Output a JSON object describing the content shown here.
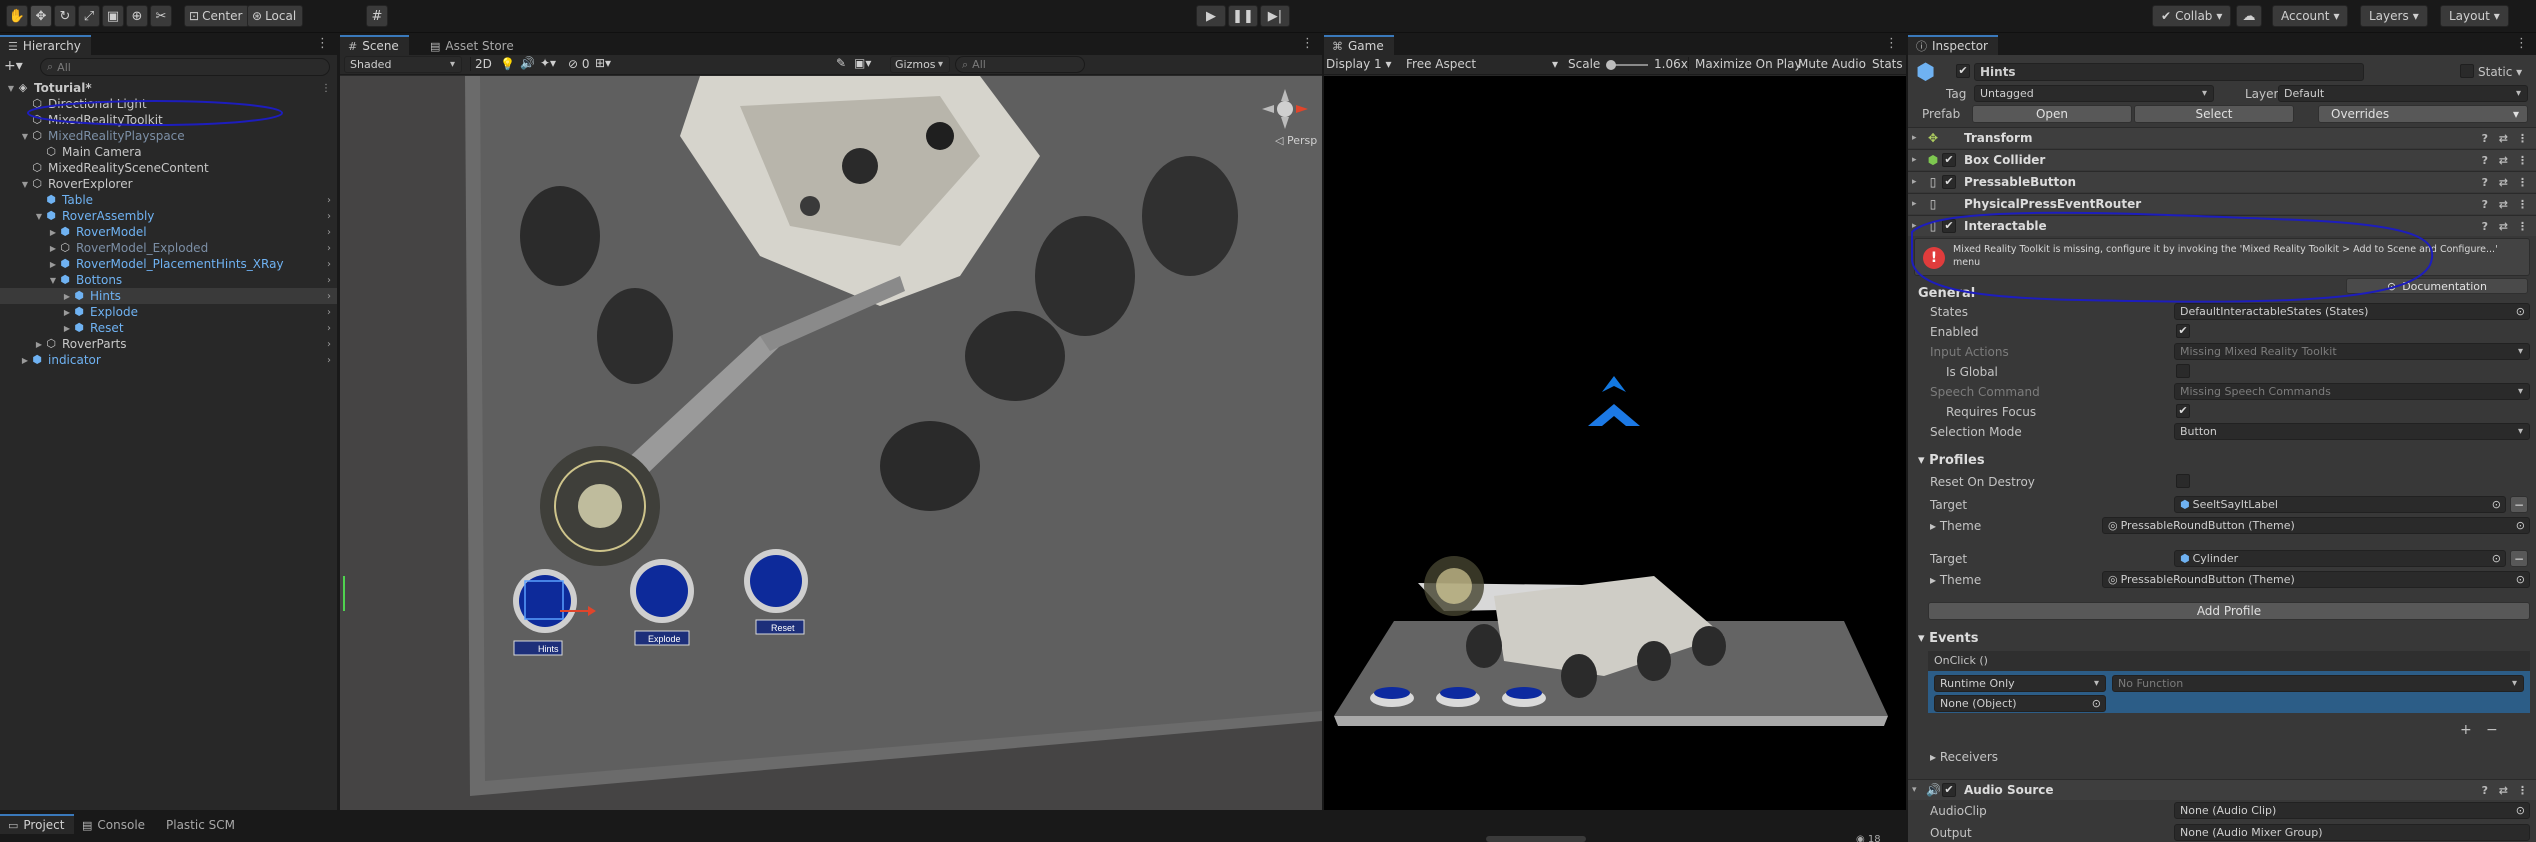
{
  "toolbar": {
    "pivot_label": "Center",
    "space_label": "Local",
    "collab_label": "Collab",
    "account_label": "Account",
    "layers_label": "Layers",
    "layout_label": "Layout"
  },
  "hierarchy": {
    "tab_label": "Hierarchy",
    "search_placeholder": "All",
    "items": [
      {
        "label": "Toturial*",
        "depth": 0
      },
      {
        "label": "Directional Light",
        "depth": 1
      },
      {
        "label": "MixedRealityToolkit",
        "depth": 1
      },
      {
        "label": "MixedRealityPlayspace",
        "depth": 1
      },
      {
        "label": "Main Camera",
        "depth": 2
      },
      {
        "label": "MixedRealitySceneContent",
        "depth": 1
      },
      {
        "label": "RoverExplorer",
        "depth": 1
      },
      {
        "label": "Table",
        "depth": 2
      },
      {
        "label": "RoverAssembly",
        "depth": 2
      },
      {
        "label": "RoverModel",
        "depth": 3
      },
      {
        "label": "RoverModel_Exploded",
        "depth": 3
      },
      {
        "label": "RoverModel_PlacementHints_XRay",
        "depth": 3
      },
      {
        "label": "Bottons",
        "depth": 3
      },
      {
        "label": "Hints",
        "depth": 4
      },
      {
        "label": "Explode",
        "depth": 4
      },
      {
        "label": "Reset",
        "depth": 4
      },
      {
        "label": "RoverParts",
        "depth": 2
      },
      {
        "label": "indicator",
        "depth": 1
      }
    ]
  },
  "scene": {
    "tab_label": "Scene",
    "tab2_label": "Asset Store",
    "shading": "Shaded",
    "mode_2d": "2D",
    "hidden_count": "0",
    "gizmos_label": "Gizmos",
    "search_placeholder": "All",
    "persp_label": "Persp",
    "buttons": [
      "Hints",
      "Explode",
      "Reset"
    ]
  },
  "game": {
    "tab_label": "Game",
    "display": "Display 1",
    "aspect": "Free Aspect",
    "scale_label": "Scale",
    "scale_value": "1.06x",
    "maximize_label": "Maximize On Play",
    "mute_label": "Mute Audio",
    "stats_label": "Stats"
  },
  "inspector": {
    "tab_label": "Inspector",
    "object_name": "Hints",
    "static_label": "Static",
    "tag_label": "Tag",
    "tag_value": "Untagged",
    "layer_label": "Layer",
    "layer_value": "Default",
    "prefab_label": "Prefab",
    "open_label": "Open",
    "select_label": "Select",
    "overrides_label": "Overrides",
    "components": [
      "Transform",
      "Box Collider",
      "PressableButton",
      "PhysicalPressEventRouter",
      "Interactable"
    ],
    "error_text": "Mixed Reality Toolkit is missing, configure it by invoking the 'Mixed Reality Toolkit > Add to Scene and Configure...' menu",
    "documentation_label": "Documentation",
    "general_label": "General",
    "states_label": "States",
    "states_value": "DefaultInteractableStates (States)",
    "enabled_label": "Enabled",
    "input_actions_label": "Input Actions",
    "input_actions_value": "Missing Mixed Reality Toolkit",
    "is_global_label": "Is Global",
    "speech_label": "Speech Command",
    "speech_value": "Missing Speech Commands",
    "requires_focus_label": "Requires Focus",
    "selection_mode_label": "Selection Mode",
    "selection_mode_value": "Button",
    "profiles_label": "Profiles",
    "reset_label": "Reset On Destroy",
    "target_label": "Target",
    "theme_label": "Theme",
    "target1_value": "SeeltSayItLabel",
    "theme1_value": "PressableRoundButton (Theme)",
    "target2_value": "Cylinder",
    "theme2_value": "PressableRoundButton (Theme)",
    "add_profile_label": "Add Profile",
    "events_label": "Events",
    "onclick_label": "OnClick ()",
    "runtime_value": "Runtime Only",
    "function_value": "No Function",
    "object_value": "None (Object)",
    "receivers_label": "Receivers",
    "audio_source_label": "Audio Source",
    "audioclip_label": "AudioClip",
    "audioclip_value": "None (Audio Clip)",
    "output_label": "Output",
    "output_value": "None (Audio Mixer Group)"
  },
  "bottom": {
    "project_label": "Project",
    "console_label": "Console",
    "plastic_label": "Plastic SCM",
    "count_label": "18"
  },
  "colors": {
    "accent": "#3a79bb",
    "error": "#e03c3c",
    "annotation": "#1d1dbd",
    "button_blue": "#0d2a9a"
  }
}
